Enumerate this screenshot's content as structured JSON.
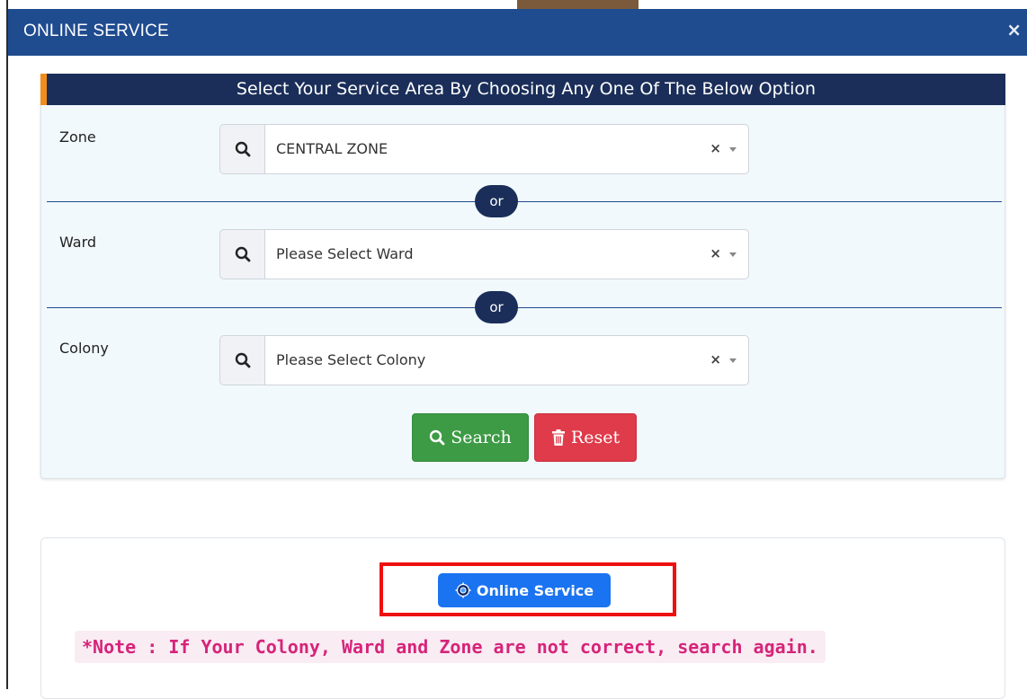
{
  "modal": {
    "title": "ONLINE SERVICE",
    "close_symbol": "×"
  },
  "form": {
    "heading": "Select Your Service Area By Choosing Any One Of The Below Option",
    "fields": [
      {
        "label": "Zone",
        "value": "CENTRAL ZONE",
        "clear": "×",
        "icon": "search-icon"
      },
      {
        "label": "Ward",
        "placeholder": "Please Select Ward",
        "clear": "×",
        "icon": "search-icon"
      },
      {
        "label": "Colony",
        "placeholder": "Please Select Colony",
        "clear": "×",
        "icon": "search-icon"
      }
    ],
    "separator": "or",
    "search_label": "Search",
    "reset_label": "Reset"
  },
  "service": {
    "button_label": "Online Service",
    "note": "*Note : If Your Colony, Ward and Zone are not correct, search again."
  },
  "colors": {
    "header": "#1f4b8f",
    "card_header": "#1a2e59",
    "accent_orange": "#f08c1a",
    "search_green": "#3d9a45",
    "reset_red": "#df3b4a",
    "online_blue": "#1a73f0",
    "highlight_red": "#ee1010",
    "note_pink": "#d6247a"
  }
}
